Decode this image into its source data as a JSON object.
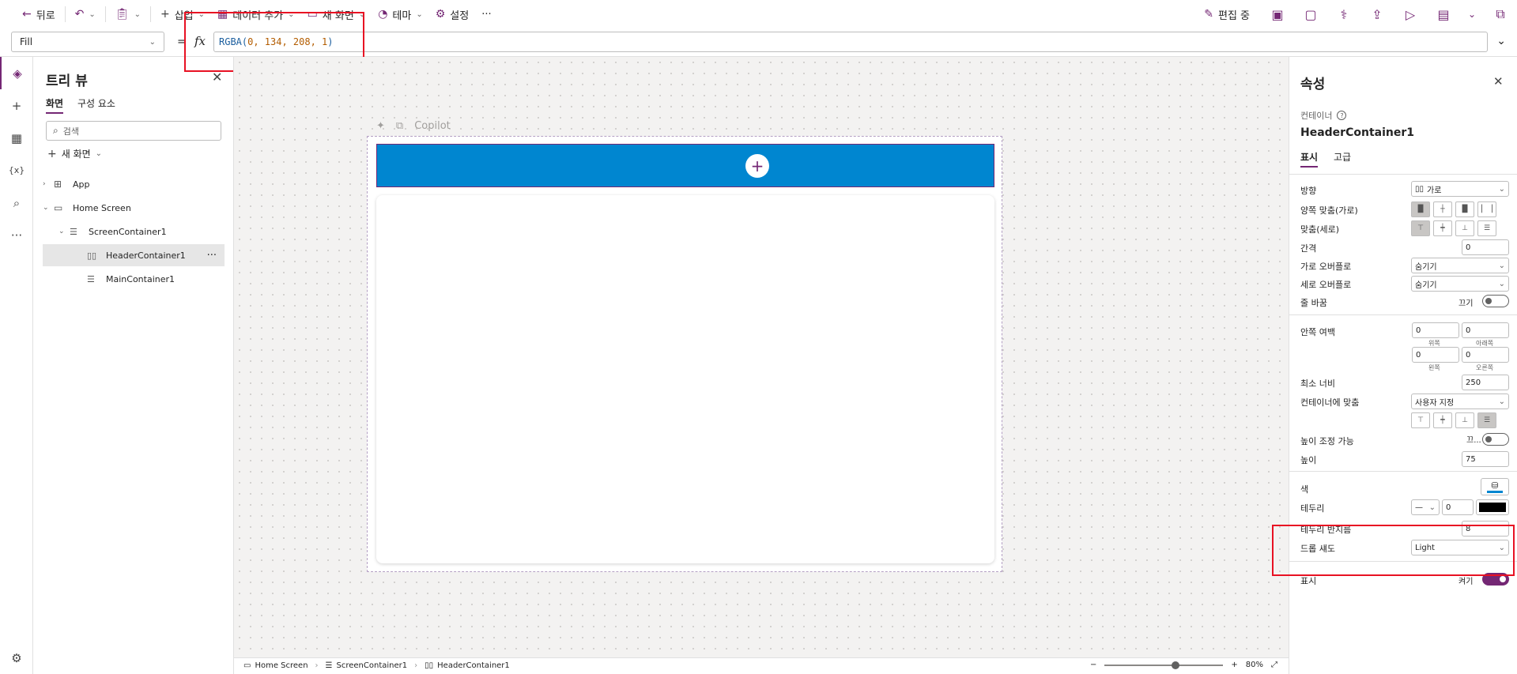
{
  "toolbar": {
    "back": "뒤로",
    "insert": "삽입",
    "add_data": "데이터 추가",
    "new_screen": "새 화면",
    "theme": "테마",
    "settings": "설정",
    "more": "···",
    "editing": "편집 중"
  },
  "formula": {
    "property": "Fill",
    "equals": "=",
    "fx": "fx",
    "func": "RGBA(",
    "args": "0, 134, 208, 1",
    "close": ")"
  },
  "tree": {
    "title": "트리 뷰",
    "tab_screens": "화면",
    "tab_components": "구성 요소",
    "search_placeholder": "검색",
    "new_screen": "새 화면",
    "items": [
      {
        "label": "App"
      },
      {
        "label": "Home Screen"
      },
      {
        "label": "ScreenContainer1"
      },
      {
        "label": "HeaderContainer1"
      },
      {
        "label": "MainContainer1"
      }
    ],
    "item_more": "···"
  },
  "canvas": {
    "copilot": "Copilot",
    "header_color": "#0086D0"
  },
  "props": {
    "title": "속성",
    "type": "컨테이너",
    "name": "HeaderContainer1",
    "tab_display": "표시",
    "tab_advanced": "고급",
    "direction_label": "방향",
    "direction_value": "가로",
    "justify_label": "양쪽 맞춤(가로)",
    "align_label": "맞춤(세로)",
    "gap_label": "간격",
    "gap_value": "0",
    "hoverflow_label": "가로 오버플로",
    "hoverflow_value": "숨기기",
    "voverflow_label": "세로 오버플로",
    "voverflow_value": "숨기기",
    "wrap_label": "줄 바꿈",
    "wrap_state": "끄기",
    "padding_label": "안쪽 여백",
    "pad_top": "0",
    "pad_bottom": "0",
    "pad_left": "0",
    "pad_right": "0",
    "pad_top_label": "위쪽",
    "pad_bottom_label": "아래쪽",
    "pad_left_label": "왼쪽",
    "pad_right_label": "오른쪽",
    "minwidth_label": "최소 너비",
    "minwidth_value": "250",
    "fit_label": "컨테이너에 맞춤",
    "fit_value": "사용자 지정",
    "resizable_label": "높이 조정 가능",
    "resizable_state": "끄...",
    "height_label": "높이",
    "height_value": "75",
    "color_label": "색",
    "border_label": "테두리",
    "border_width": "0",
    "radius_label": "테두리 반지름",
    "radius_value": "8",
    "shadow_label": "드롭 섀도",
    "shadow_value": "Light",
    "visible_label": "표시",
    "visible_state": "켜기"
  },
  "status": {
    "crumb1": "Home Screen",
    "crumb2": "ScreenContainer1",
    "crumb3": "HeaderContainer1",
    "zoom": "80%"
  }
}
